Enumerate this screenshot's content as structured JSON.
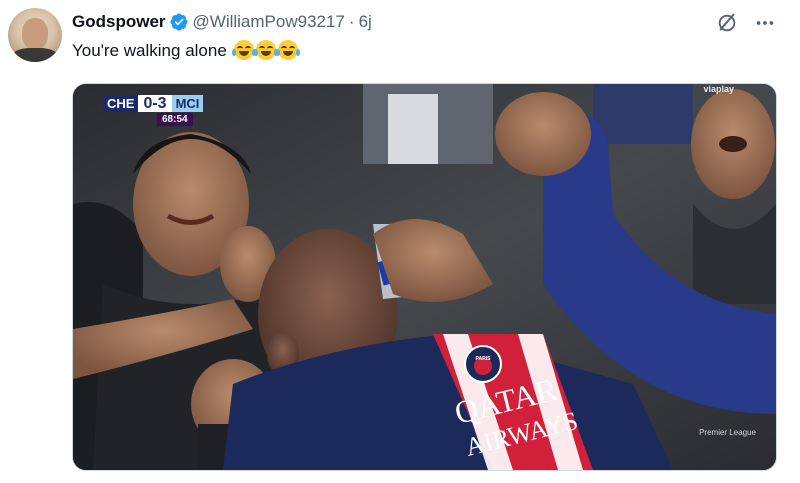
{
  "author": {
    "display_name": "Godspower",
    "handle": "@WilliamPow93217",
    "separator": "·",
    "timestamp": "6j",
    "verified": true,
    "verified_color": "#1d9bf0"
  },
  "tweet": {
    "text": "You're walking alone",
    "emoji_count": 3,
    "emoji_name": "face-with-tears-of-joy"
  },
  "media": {
    "scoreboard": {
      "home": "CHE",
      "score": "0-3",
      "away": "MCI",
      "clock": "68:54"
    },
    "broadcaster": "viaplay",
    "league_watermark": "Premier League",
    "shirt_sponsor": [
      "QATAR",
      "AIRWAYS"
    ],
    "shirt_crest": "PARIS"
  },
  "icons": {
    "grok": "grok-icon",
    "more": "more-options-icon",
    "verified": "verified-badge-icon"
  },
  "colors": {
    "text": "#0f1419",
    "secondary": "#536471",
    "accent": "#1d9bf0",
    "psg_navy": "#1b2a5a",
    "psg_red": "#d0203a"
  }
}
